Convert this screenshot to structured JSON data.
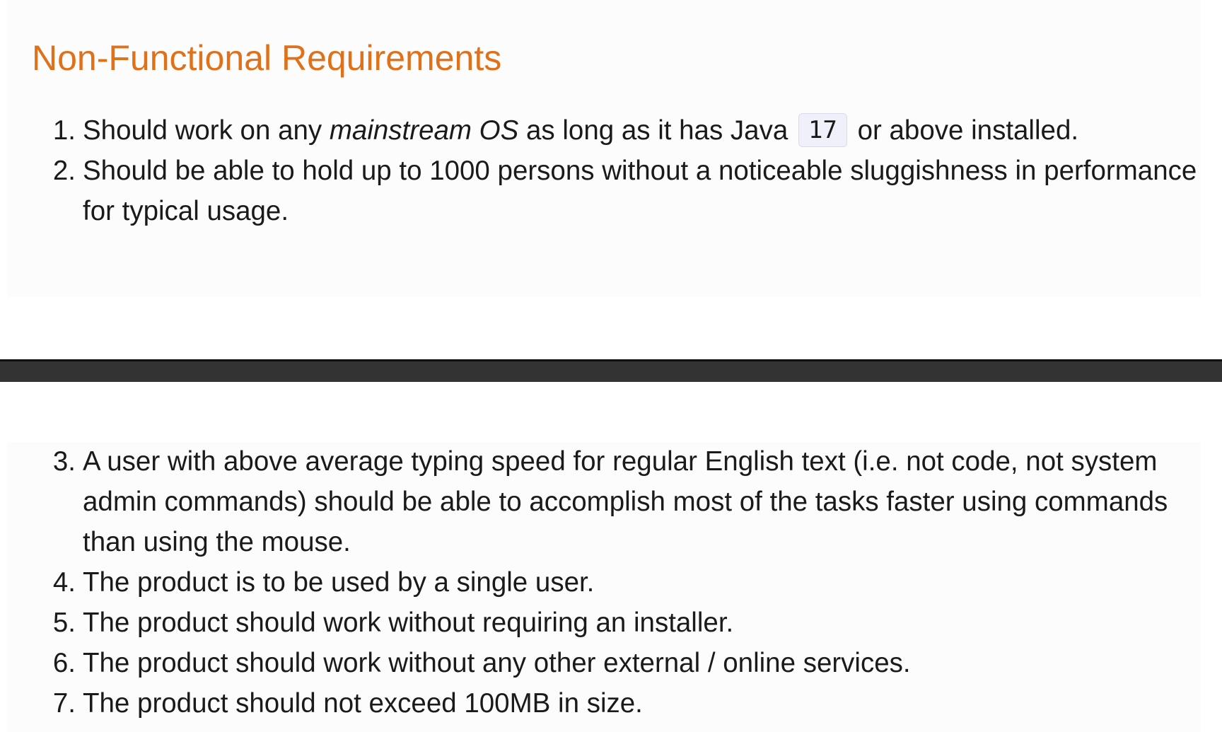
{
  "heading": "Non-Functional Requirements",
  "requirements_top": [
    {
      "number": "1.",
      "parts": {
        "a": "Should work on any ",
        "b": "mainstream OS",
        "c": " as long as it has Java ",
        "code": "17",
        "d": " or above installed."
      }
    },
    {
      "number": "2.",
      "text": "Should be able to hold up to 1000 persons without a noticeable sluggishness in performance for typical usage."
    }
  ],
  "requirements_bottom": [
    {
      "number": "3.",
      "text": "A user with above average typing speed for regular English text (i.e. not code, not system admin commands) should be able to accomplish most of the tasks faster using commands than using the mouse."
    },
    {
      "number": "4.",
      "text": "The product is to be used by a single user."
    },
    {
      "number": "5.",
      "text": "The product should work without requiring an installer."
    },
    {
      "number": "6.",
      "text": "The product should work without any other external / online services."
    },
    {
      "number": "7.",
      "text": "The product should not exceed 100MB in size."
    }
  ],
  "colors": {
    "heading": "#e0711b",
    "divider": "#333333",
    "panel_background": "#fcfcfc"
  }
}
